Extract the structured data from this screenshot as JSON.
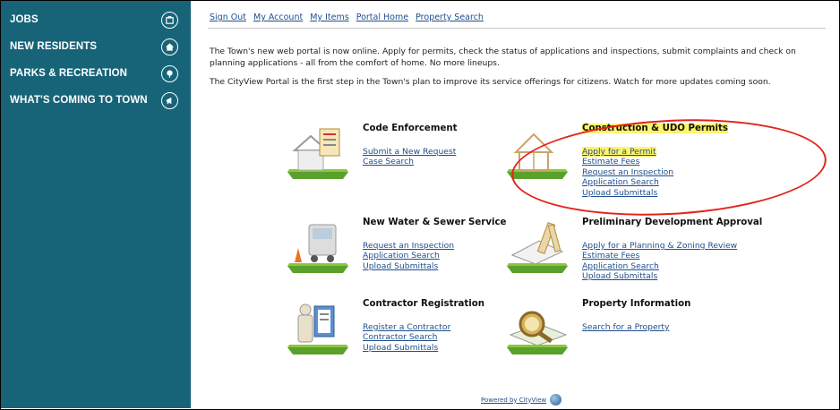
{
  "sidebar": {
    "items": [
      {
        "label": "JOBS",
        "icon": "briefcase-icon"
      },
      {
        "label": "NEW RESIDENTS",
        "icon": "home-icon"
      },
      {
        "label": "PARKS & RECREATION",
        "icon": "tree-icon"
      },
      {
        "label": "WHAT'S COMING TO TOWN",
        "icon": "megaphone-icon"
      }
    ]
  },
  "top_links": [
    "Sign Out",
    "My Account",
    "My Items",
    "Portal Home",
    "Property Search"
  ],
  "intro": {
    "p1": "The Town's new web portal is now online. Apply for permits, check the status of applications and inspections, submit complaints and check on planning applications - all from the comfort of home. No more lineups.",
    "p2": "The CityView Portal is the first step in the Town's plan to improve its service offerings for citizens. Watch for more updates coming soon."
  },
  "sections": {
    "code_enforcement": {
      "title": "Code Enforcement",
      "links": [
        "Submit a New Request",
        "Case Search"
      ]
    },
    "construction": {
      "title": "Construction & UDO Permits",
      "links": [
        "Apply for a Permit",
        "Estimate Fees",
        "Request an Inspection",
        "Application Search",
        "Upload Submittals"
      ]
    },
    "water_sewer": {
      "title": "New Water & Sewer Service",
      "links": [
        "Request an Inspection",
        "Application Search",
        "Upload Submittals"
      ]
    },
    "preliminary": {
      "title": "Preliminary Development Approval",
      "links": [
        "Apply for a Planning & Zoning Review",
        "Estimate Fees",
        "Application Search",
        "Upload Submittals"
      ]
    },
    "contractor": {
      "title": "Contractor Registration",
      "links": [
        "Register a Contractor",
        "Contractor Search",
        "Upload Submittals"
      ]
    },
    "property": {
      "title": "Property Information",
      "links": [
        "Search for a Property"
      ]
    }
  },
  "footer": {
    "label": "Powered by CityView"
  },
  "colors": {
    "sidebar": "#176479",
    "link": "#1f4e8c",
    "highlight": "#fff36a",
    "annotation": "#e2231a"
  }
}
